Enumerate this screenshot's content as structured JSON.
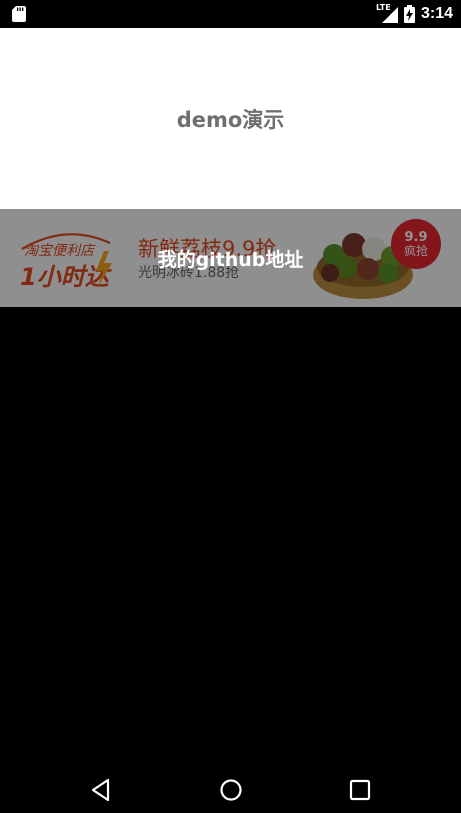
{
  "status_bar": {
    "network_label": "LTE",
    "time": "3:14",
    "icons": [
      "sd-card-icon",
      "signal-icon",
      "battery-icon"
    ]
  },
  "demo": {
    "title": "demo演示"
  },
  "banner": {
    "store_logo_line1": "淘宝便利店",
    "store_logo_line2": "1小时达",
    "promo_title": "新鲜荔枝9.9抢",
    "promo_subtitle": "光明冰砖1.88抢",
    "badge_price": "9.9",
    "badge_text": "疯抢",
    "link_text": "我的github地址"
  },
  "nav_bar": {
    "icons": [
      "back-icon",
      "home-icon",
      "recents-icon"
    ]
  },
  "colors": {
    "accent_red": "#e0262f",
    "promo_orange": "#e0471f",
    "title_gray": "#6f6f6f"
  }
}
